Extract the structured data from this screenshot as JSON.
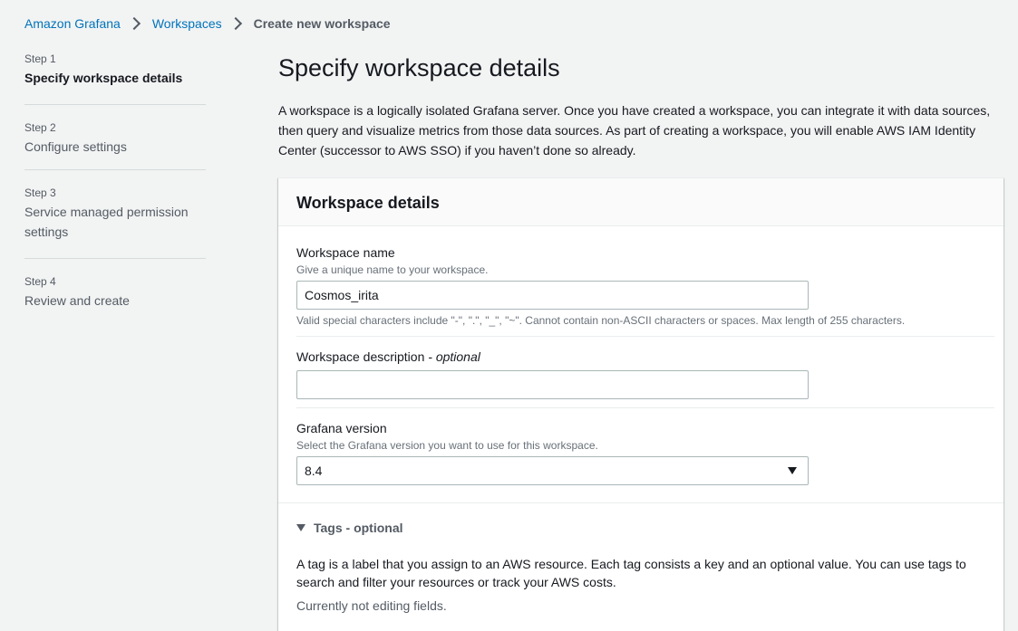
{
  "breadcrumb": {
    "items": [
      "Amazon Grafana",
      "Workspaces"
    ],
    "current": "Create new workspace"
  },
  "steps": [
    {
      "number": "Step 1",
      "title": "Specify workspace details",
      "active": true
    },
    {
      "number": "Step 2",
      "title": "Configure settings",
      "active": false
    },
    {
      "number": "Step 3",
      "title": "Service managed permission settings",
      "active": false
    },
    {
      "number": "Step 4",
      "title": "Review and create",
      "active": false
    }
  ],
  "page": {
    "title": "Specify workspace details",
    "intro": "A workspace is a logically isolated Grafana server. Once you have created a workspace, you can integrate it with data sources, then query and visualize metrics from those data sources. As part of creating a workspace, you will enable AWS IAM Identity Center (successor to AWS SSO) if you haven’t done so already."
  },
  "panel": {
    "title": "Workspace details",
    "name_field": {
      "label": "Workspace name",
      "description": "Give a unique name to your workspace.",
      "value": "Cosmos_irita",
      "constraint": "Valid special characters include \"-\", \".\", \"_\", \"~\". Cannot contain non-ASCII characters or spaces. Max length of 255 characters."
    },
    "description_field": {
      "label": "Workspace description",
      "optional": "- optional",
      "value": ""
    },
    "version_field": {
      "label": "Grafana version",
      "description": "Select the Grafana version you want to use for this workspace.",
      "selected": "8.4"
    },
    "tags": {
      "toggle_label": "Tags - optional",
      "text": "A tag is a label that you assign to an AWS resource. Each tag consists a key and an optional value. You can use tags to search and filter your resources or track your AWS costs.",
      "status": "Currently not editing fields."
    }
  },
  "colors": {
    "link": "#0073bb",
    "background": "#f2f3f3",
    "text": "#16191f",
    "muted": "#545b64"
  }
}
